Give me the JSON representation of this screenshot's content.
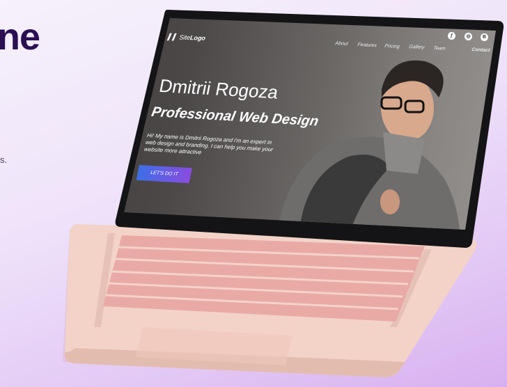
{
  "backdrop": {
    "heading_fragment": "ne",
    "text_fragment": "s."
  },
  "site": {
    "logo_prefix": "Site",
    "logo_bold": "Logo",
    "nav": [
      "About",
      "Features",
      "Pricing",
      "Gallery",
      "Team"
    ],
    "contact": "Contact",
    "social_icons": [
      "brush-icon",
      "dribbble-icon",
      "behance-icon"
    ]
  },
  "hero": {
    "name": "Dmitrii Rogoza",
    "title": "Professional Web Design",
    "text": "Hi! My name is Dmitrii Rogoza and i'm an expert in web design and branding. I can help you make your website more attractive",
    "cta": "LET'S DO IT"
  },
  "colors": {
    "brand_dark": "#2a0f52",
    "cta_start": "#3d6ee6",
    "cta_end": "#8a4ce0",
    "laptop_body": "#f0cfc4"
  }
}
